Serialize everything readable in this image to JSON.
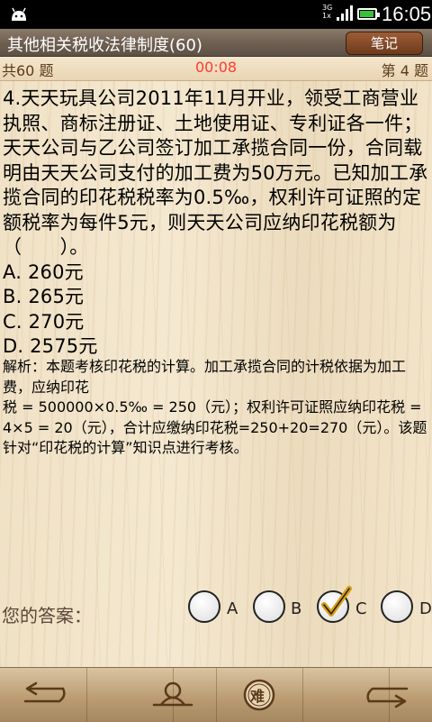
{
  "status": {
    "network": "3G",
    "network2": "1x",
    "time": "16:05",
    "battery_level": 0.8
  },
  "titlebar": {
    "title": "其他相关税收法律制度(60)",
    "notes_label": "笔记"
  },
  "info": {
    "total": "共60 题",
    "timer": "00:08",
    "question_number": "第 4 题"
  },
  "question": {
    "stem": "4.天天玩具公司2011年11月开业，领受工商营业执照、商标注册证、土地使用证、专利证各一件；天天公司与乙公司签订加工承揽合同一份，合同载明由天天公司支付的加工费为50万元。已知加工承揽合同的印花税税率为0.5‰，权利许可证照的定额税率为每件5元，则天天公司应纳印花税额为（　　）。",
    "options": [
      "A. 260元",
      "B. 265元",
      "C. 270元",
      "D. 2575元"
    ]
  },
  "analysis": {
    "lines": [
      "解析：本题考核印花税的计算。加工承揽合同的计税依据为加工费，应纳印花",
      "税 = 500000×0.5‰ = 250（元）；权利许可证照应纳印花税 = 4×5 = 20（元），合计应缴纳印花税=250+20=270（元）。该题针对“印花税的计算”知识点进行考核。"
    ]
  },
  "answer": {
    "label": "您的答案：",
    "choices": [
      "A",
      "B",
      "C",
      "D"
    ],
    "selected": "C"
  },
  "toolbar": {
    "buttons": [
      "prev-arrow-icon",
      "user-icon",
      "difficulty-icon",
      "next-arrow-icon"
    ],
    "difficulty_label": "难"
  }
}
